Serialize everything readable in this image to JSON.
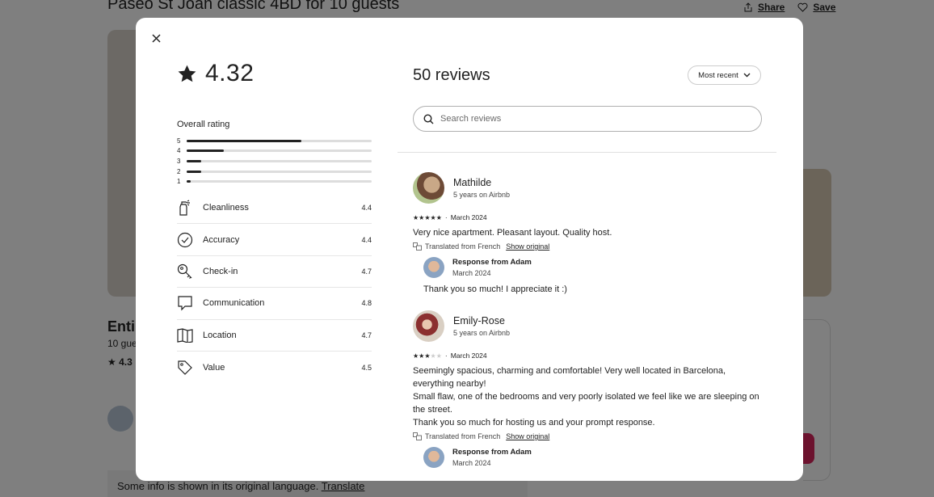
{
  "background": {
    "title": "Paseo St Joan classic 4BD for 10 guests",
    "share_label": "Share",
    "save_label": "Save",
    "subtitle": "Enti",
    "guests": "10 gue",
    "rating": "4.3",
    "note_text": "Some info is shown in its original language. ",
    "note_link": "Translate"
  },
  "modal": {
    "overall_score": "4.32",
    "overall_label": "Overall rating",
    "distribution": [
      {
        "stars": "5",
        "fraction": 0.62
      },
      {
        "stars": "4",
        "fraction": 0.2
      },
      {
        "stars": "3",
        "fraction": 0.08
      },
      {
        "stars": "2",
        "fraction": 0.08
      },
      {
        "stars": "1",
        "fraction": 0.02
      }
    ],
    "categories": [
      {
        "label": "Cleanliness",
        "score": "4.4",
        "icon": "spray-bottle-icon"
      },
      {
        "label": "Accuracy",
        "score": "4.4",
        "icon": "check-circle-icon"
      },
      {
        "label": "Check-in",
        "score": "4.7",
        "icon": "key-icon"
      },
      {
        "label": "Communication",
        "score": "4.8",
        "icon": "chat-bubble-icon"
      },
      {
        "label": "Location",
        "score": "4.7",
        "icon": "map-icon"
      },
      {
        "label": "Value",
        "score": "4.5",
        "icon": "tag-icon"
      }
    ],
    "reviews_heading": "50 reviews",
    "sort_label": "Most recent",
    "search_placeholder": "Search reviews",
    "reviews": [
      {
        "name": "Mathilde",
        "meta": "5 years on Airbnb",
        "stars": 5,
        "date": "March 2024",
        "text": "Very nice apartment. Pleasant layout. Quality host.",
        "translated_label": "Translated from French",
        "show_original": "Show original",
        "response": {
          "title": "Response from Adam",
          "date": "March 2024",
          "text": "Thank you so much! I appreciate it :)"
        }
      },
      {
        "name": "Emily-Rose",
        "meta": "5 years on Airbnb",
        "stars": 3,
        "date": "March 2024",
        "text_lines": [
          "Seemingly spacious, charming and comfortable! Very well located in Barcelona, everything nearby!",
          "Small flaw, one of the bedrooms and very poorly isolated we feel like we are sleeping on the street.",
          "Thank you so much for hosting us and your prompt response."
        ],
        "translated_label": "Translated from French",
        "show_original": "Show original",
        "response": {
          "title": "Response from Adam",
          "date": "March 2024"
        }
      }
    ]
  }
}
